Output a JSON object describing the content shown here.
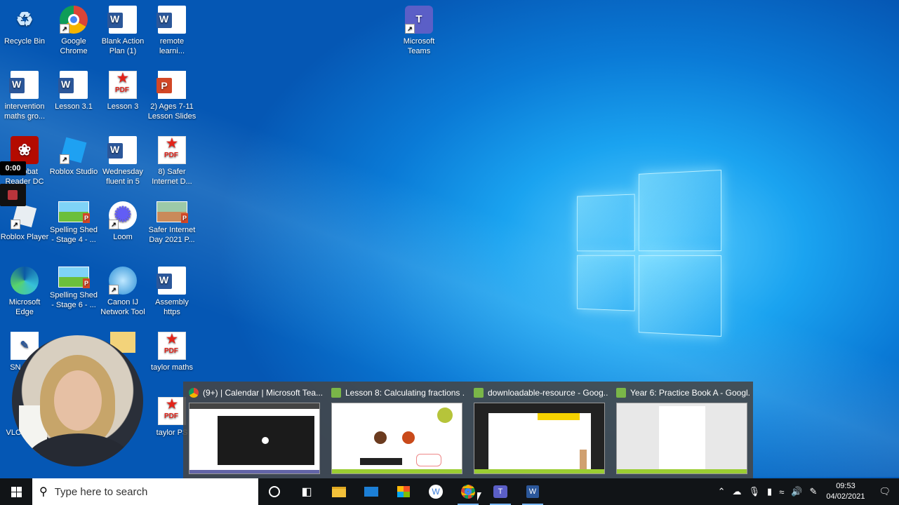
{
  "desktop_icons": [
    {
      "id": "recycle",
      "label": "Recycle Bin",
      "icon": "recycle-bin-icon"
    },
    {
      "id": "chrome",
      "label": "Google Chrome",
      "icon": "chrome-icon"
    },
    {
      "id": "blank-action",
      "label": "Blank Action Plan (1)",
      "icon": "word-icon"
    },
    {
      "id": "remote",
      "label": "remote learni...",
      "icon": "word-icon"
    },
    {
      "id": "teams",
      "label": "Microsoft Teams",
      "icon": "teams-icon"
    },
    {
      "id": "intervention",
      "label": "intervention maths gro...",
      "icon": "word-icon"
    },
    {
      "id": "lesson31",
      "label": "Lesson 3.1",
      "icon": "word-icon"
    },
    {
      "id": "lesson3",
      "label": "Lesson 3",
      "icon": "pdf-icon"
    },
    {
      "id": "ages711",
      "label": "2) Ages 7-11 Lesson Slides",
      "icon": "powerpoint-icon"
    },
    {
      "id": "acrobat",
      "label": "Acrobat Reader DC",
      "icon": "acrobat-icon"
    },
    {
      "id": "roblox-studio",
      "label": "Roblox Studio",
      "icon": "roblox-studio-icon"
    },
    {
      "id": "wednesday",
      "label": "Wednesday fluent in 5",
      "icon": "word-icon"
    },
    {
      "id": "safer8",
      "label": "8) Safer Internet D...",
      "icon": "pdf-icon"
    },
    {
      "id": "roblox-player",
      "label": "Roblox Player",
      "icon": "roblox-icon"
    },
    {
      "id": "spelling4",
      "label": "Spelling Shed - Stage 4 - ...",
      "icon": "spelling-shed-icon"
    },
    {
      "id": "loom",
      "label": "Loom",
      "icon": "loom-icon"
    },
    {
      "id": "safer2021",
      "label": "Safer Internet Day 2021 P...",
      "icon": "spelling-shed-icon"
    },
    {
      "id": "edge",
      "label": "Microsoft Edge",
      "icon": "edge-icon"
    },
    {
      "id": "spelling6",
      "label": "Spelling Shed - Stage 6 - ...",
      "icon": "spelling-shed-icon"
    },
    {
      "id": "canon",
      "label": "Canon IJ Network Tool",
      "icon": "canon-icon"
    },
    {
      "id": "assembly",
      "label": "Assembly https",
      "icon": "word-icon"
    },
    {
      "id": "taylor-maths",
      "label": "taylor maths",
      "icon": "pdf-icon"
    },
    {
      "id": "taylor-ps",
      "label": "taylor PS",
      "icon": "pdf-icon"
    },
    {
      "id": "sn-partial",
      "label": "SN No...",
      "icon": "app-icon"
    },
    {
      "id": "vlc-partial",
      "label": "VLC play...",
      "icon": "vlc-icon"
    }
  ],
  "recorder": {
    "timer": "0:00"
  },
  "previews": [
    {
      "title": "(9+) | Calendar | Microsoft Tea...",
      "icon": "chrome-icon",
      "color": "#db4437"
    },
    {
      "title": "Lesson 8: Calculating fractions ...",
      "icon": "oak-icon",
      "color": "#7ab648"
    },
    {
      "title": "downloadable-resource - Goog...",
      "icon": "oak-icon",
      "color": "#7ab648"
    },
    {
      "title": "Year 6: Practice Book A - Googl...",
      "icon": "oak-icon",
      "color": "#7ab648"
    }
  ],
  "taskbar": {
    "search_placeholder": "Type here to search",
    "time": "09:53",
    "date": "04/02/2021"
  },
  "colors": {
    "accent": "#0a7ad6",
    "taskbar": "#111417"
  }
}
